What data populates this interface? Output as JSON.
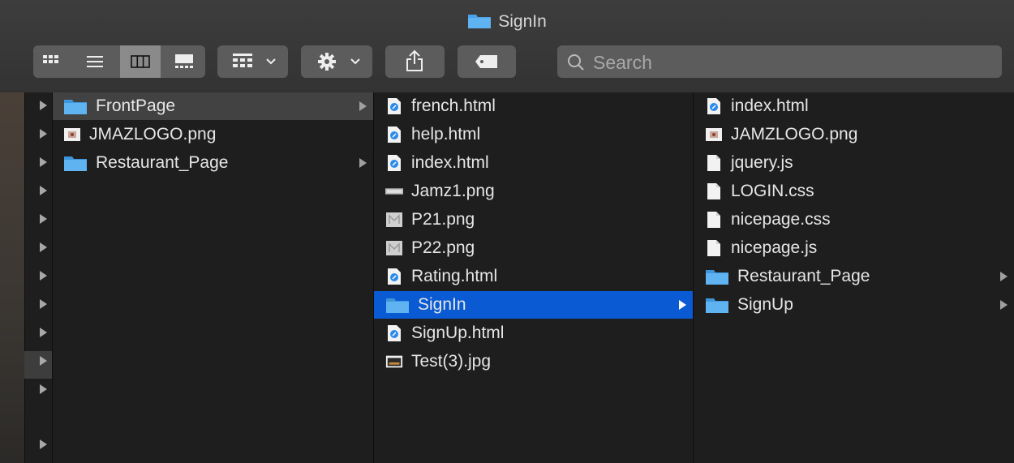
{
  "window": {
    "title": "SignIn"
  },
  "toolbar": {
    "view_modes": [
      "icon-view-icon",
      "list-view-icon",
      "column-view-icon",
      "gallery-view-icon"
    ],
    "selected_view": "column-view-icon",
    "group_icon": "group-icon",
    "action_icon": "gear-icon",
    "share_icon": "share-icon",
    "tag_icon": "tag-icon",
    "search_placeholder": "Search"
  },
  "columns": [
    {
      "items": [
        {
          "name": "FrontPage",
          "type": "folder",
          "folder": true,
          "state": "gray"
        },
        {
          "name": "JMAZLOGO.png",
          "type": "png"
        },
        {
          "name": "Restaurant_Page",
          "type": "folder",
          "folder": true
        }
      ]
    },
    {
      "items": [
        {
          "name": "french.html",
          "type": "html"
        },
        {
          "name": "help.html",
          "type": "html"
        },
        {
          "name": "index.html",
          "type": "html"
        },
        {
          "name": "Jamz1.png",
          "type": "banner"
        },
        {
          "name": "P21.png",
          "type": "png-gray"
        },
        {
          "name": "P22.png",
          "type": "png-gray"
        },
        {
          "name": "Rating.html",
          "type": "html"
        },
        {
          "name": "SignIn",
          "type": "folder",
          "folder": true,
          "state": "blue"
        },
        {
          "name": "SignUp.html",
          "type": "html"
        },
        {
          "name": "Test(3).jpg",
          "type": "jpg"
        }
      ]
    },
    {
      "items": [
        {
          "name": "index.html",
          "type": "html"
        },
        {
          "name": "JAMZLOGO.png",
          "type": "png"
        },
        {
          "name": "jquery.js",
          "type": "doc"
        },
        {
          "name": "LOGIN.css",
          "type": "doc"
        },
        {
          "name": "nicepage.css",
          "type": "doc"
        },
        {
          "name": "nicepage.js",
          "type": "doc"
        },
        {
          "name": "Restaurant_Page",
          "type": "folder",
          "folder": true
        },
        {
          "name": "SignUp",
          "type": "folder",
          "folder": true
        }
      ]
    }
  ],
  "colors": {
    "selection": "#0a5bd3",
    "folder": "#4aa3e8",
    "background": "#1e1e1e"
  }
}
